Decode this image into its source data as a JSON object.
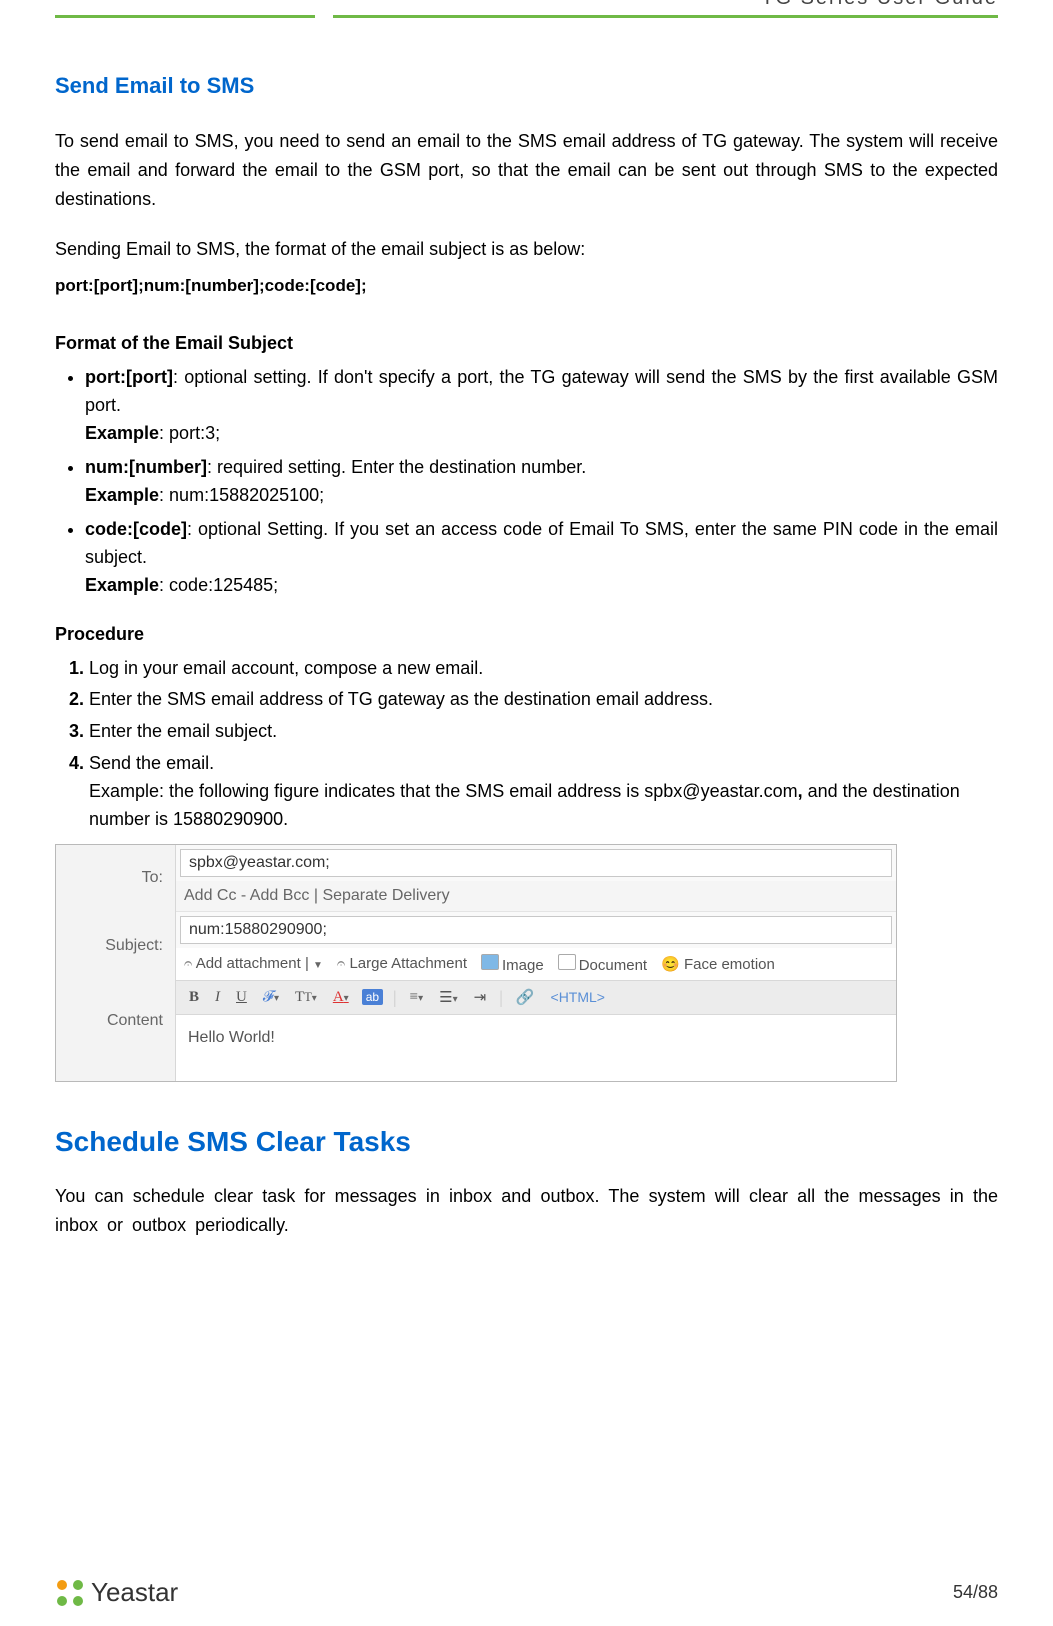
{
  "header": {
    "title": "TG  Series  User  Guide"
  },
  "section1": {
    "heading": "Send Email to SMS",
    "intro": "To send email to SMS, you need to send an email to the SMS email address of TG gateway. The system will receive the email and forward the email to the GSM port, so that the email can be sent out through SMS to the expected destinations.",
    "format_lead": "Sending Email to SMS, the format of the email subject is as below:",
    "format_code": "port:[port];num:[number];code:[code];",
    "format_heading": "Format of the Email Subject",
    "bullets": {
      "b1": {
        "key": "port:[port]",
        "desc": ": optional setting. If don't specify a port, the TG gateway will send the SMS by the first available GSM port.",
        "ex_lbl": "Example",
        "ex": ": port:3;"
      },
      "b2": {
        "key": "num:[number]",
        "desc": ": required setting. Enter the destination number.",
        "ex_lbl": "Example",
        "ex": ": num:15882025100;"
      },
      "b3": {
        "key": "code:[code]",
        "desc": ": optional Setting. If you set an access code of Email To SMS, enter the same PIN code in the email subject.",
        "ex_lbl": "Example",
        "ex": ": code:125485;"
      }
    },
    "procedure_heading": "Procedure",
    "steps": {
      "s1": "Log in your email account, compose a new email.",
      "s2": "Enter the SMS email address of TG gateway as the destination email address.",
      "s3": "Enter the email subject.",
      "s4a": "Send the email.",
      "s4b_pre": "Example: the following figure indicates that the SMS email address is spbx@yeastar.com",
      "s4b_bold": ",",
      "s4b_post": " and the destination number is 15880290900."
    }
  },
  "figure": {
    "labels": {
      "to": "To:",
      "subject": "Subject:",
      "content": "Content"
    },
    "to_value": "spbx@yeastar.com;",
    "cc_line": "Add Cc - Add Bcc | Separate Delivery",
    "subject_value": "num:15880290900;",
    "attach": {
      "add": "Add attachment",
      "large": "Large Attachment",
      "image": "Image",
      "document": "Document",
      "face": "Face emotion"
    },
    "editor": {
      "html": "<HTML>"
    },
    "body": "Hello World!"
  },
  "section2": {
    "heading": "Schedule SMS Clear Tasks",
    "para": "You can schedule clear task for messages in inbox and outbox. The system will clear all the messages in the inbox or outbox periodically."
  },
  "footer": {
    "brand": "Yeastar",
    "page": "54/88"
  }
}
